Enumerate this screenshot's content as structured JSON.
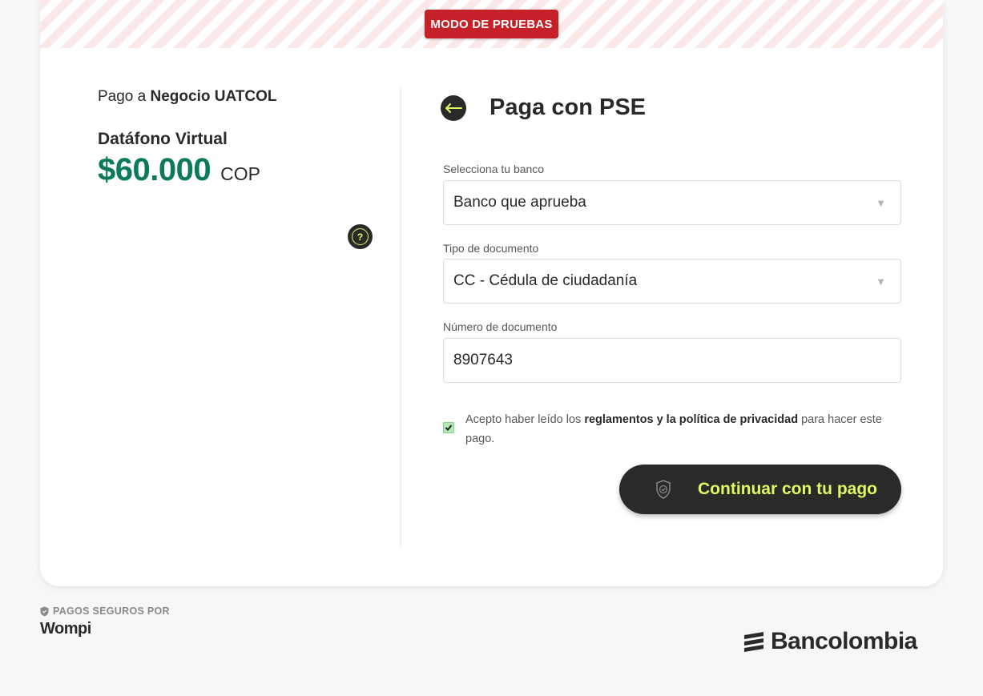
{
  "test_mode": {
    "label": "MODO DE PRUEBAS"
  },
  "summary": {
    "pay_to_prefix": "Pago a",
    "merchant": "Negocio UATCOL",
    "product": "Datáfono Virtual",
    "amount": "$60.000",
    "currency": "COP",
    "help_icon": "question-circle-icon"
  },
  "form": {
    "back_icon": "arrow-left-icon",
    "title": "Paga con PSE",
    "bank": {
      "label": "Selecciona tu banco",
      "value": "Banco que aprueba"
    },
    "doc_type": {
      "label": "Tipo de documento",
      "value": "CC - Cédula de ciudadanía"
    },
    "doc_number": {
      "label": "Número de documento",
      "value": "8907643"
    },
    "consent": {
      "checked": true,
      "prefix": "Acepto haber leído los",
      "link": "reglamentos y la política de privacidad",
      "suffix": "para hacer este pago."
    },
    "submit": {
      "icon": "shield-check-icon",
      "label": "Continuar con tu pago"
    }
  },
  "footer": {
    "secure_label": "PAGOS SEGUROS POR",
    "secure_icon": "shield-icon",
    "brand": "Wompi",
    "partner": "Bancolombia"
  },
  "colors": {
    "accent": "#dff863",
    "dark": "#2c2a29",
    "amount": "#0b7a5a",
    "test_badge": "#c62128"
  }
}
